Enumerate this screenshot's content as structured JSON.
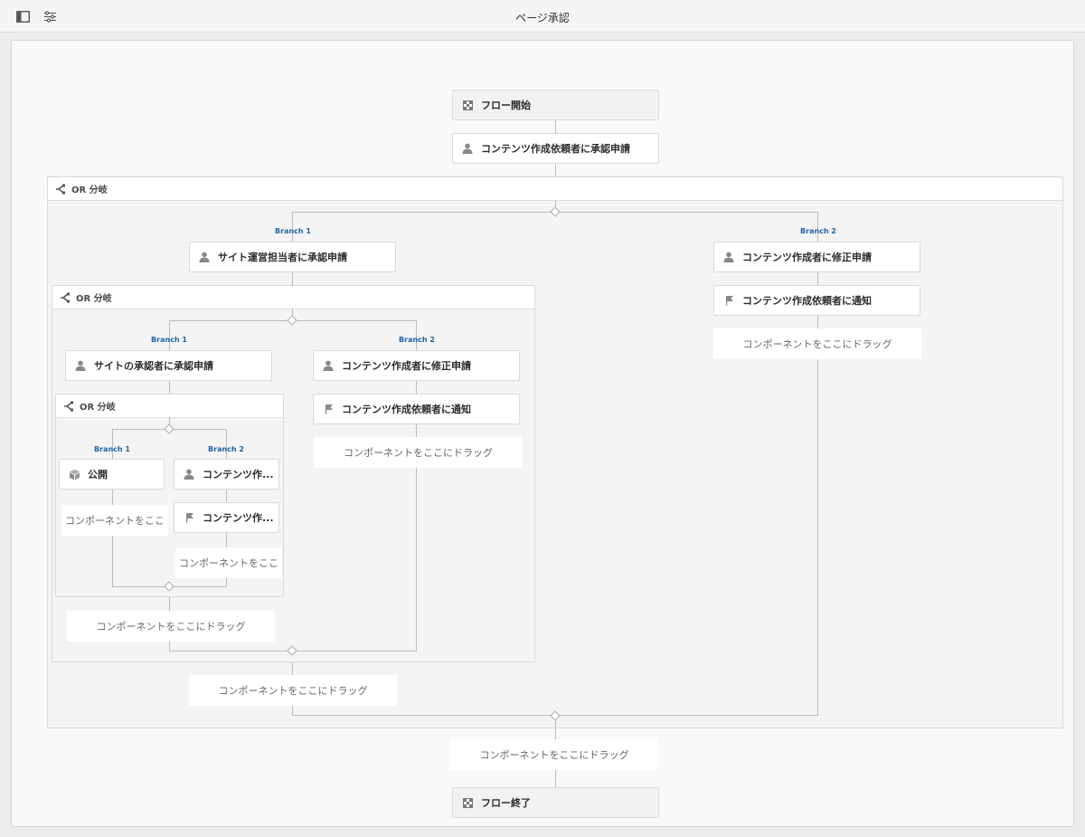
{
  "header": {
    "title": "ページ承認",
    "icons": [
      "sidebar-toggle-icon",
      "settings-sliders-icon"
    ]
  },
  "flow_start": "フロー開始",
  "flow_end": "フロー終了",
  "drop_text": "コンポーネントをここにドラッグ",
  "drop_text_short": "コンポーネントをここ",
  "steps": {
    "request_requester": "コンテンツ作成依頼者に承認申請",
    "site_manager": "サイト運営担当者に承認申請",
    "site_approver": "サイトの承認者に承認申請",
    "creator_revision": "コンテンツ作成者に修正申請",
    "notify_requester": "コンテンツ作成依頼者に通知",
    "publish": "公開",
    "creator_short": "コンテンツ作...",
    "notify_short": "コンテンツ作..."
  },
  "split_label": "OR 分岐",
  "branch1": "Branch 1",
  "branch2": "Branch 2",
  "colors": {
    "branch_label": "#2065a8",
    "connector": "#bcbcbc",
    "canvas": "#f9f9f9"
  }
}
